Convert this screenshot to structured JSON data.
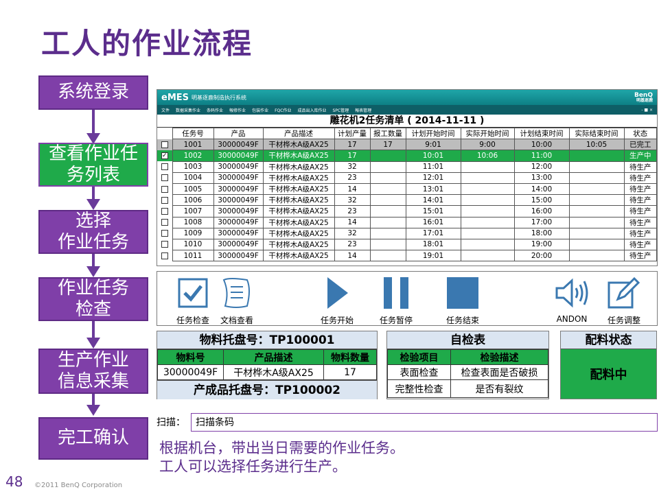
{
  "title": "工人的作业流程",
  "steps": [
    "系统登录",
    "查看作业任务列表",
    "选择作业任务",
    "作业任务检查",
    "生产作业信息采集",
    "完工确认"
  ],
  "step_lines": {
    "s2a": "查看作业任",
    "s2b": "务列表",
    "s3a": "选择",
    "s3b": "作业任务",
    "s4a": "作业任务",
    "s4b": "检查",
    "s5a": "生产作业",
    "s5b": "信息采集"
  },
  "app": {
    "logo": "eMES",
    "subtitle": "明基逐鹿制造执行系统",
    "brand_top": "BenQ",
    "brand_bottom": "明基逐鹿",
    "menu": [
      "文件",
      "数据采集作业",
      "条码作业",
      "報修作业",
      "包装作业",
      "FQC作业",
      "成品出入库作业",
      "SPC管理",
      "報表管理"
    ],
    "win_controls": "- ■ ×",
    "list_title": "雕花机2任务清单 ( 2014-11-11 )",
    "columns": [
      "任务号",
      "产品",
      "产品描述",
      "计划产量",
      "报工数量",
      "计划开始时间",
      "实际开始时间",
      "计划结束时间",
      "实际结束时间",
      "状态"
    ],
    "rows": [
      {
        "checked": false,
        "id": "1001",
        "product": "30000049F",
        "desc": "干材桦木A级AX25",
        "plan_qty": "17",
        "report_qty": "17",
        "plan_start": "9:01",
        "actual_start": "9:00",
        "plan_end": "10:00",
        "actual_end": "10:05",
        "status": "已完工"
      },
      {
        "checked": true,
        "id": "1002",
        "product": "30000049F",
        "desc": "干材桦木A级AX25",
        "plan_qty": "17",
        "report_qty": "",
        "plan_start": "10:01",
        "actual_start": "10:06",
        "plan_end": "11:00",
        "actual_end": "",
        "status": "生产中"
      },
      {
        "checked": false,
        "id": "1003",
        "product": "30000049F",
        "desc": "干材桦木A级AX25",
        "plan_qty": "32",
        "report_qty": "",
        "plan_start": "11:01",
        "actual_start": "",
        "plan_end": "12:00",
        "actual_end": "",
        "status": "待生产"
      },
      {
        "checked": false,
        "id": "1004",
        "product": "30000049F",
        "desc": "干材桦木A级AX25",
        "plan_qty": "23",
        "report_qty": "",
        "plan_start": "12:01",
        "actual_start": "",
        "plan_end": "13:00",
        "actual_end": "",
        "status": "待生产"
      },
      {
        "checked": false,
        "id": "1005",
        "product": "30000049F",
        "desc": "干材桦木A级AX25",
        "plan_qty": "14",
        "report_qty": "",
        "plan_start": "13:01",
        "actual_start": "",
        "plan_end": "14:00",
        "actual_end": "",
        "status": "待生产"
      },
      {
        "checked": false,
        "id": "1006",
        "product": "30000049F",
        "desc": "干材桦木A级AX25",
        "plan_qty": "32",
        "report_qty": "",
        "plan_start": "14:01",
        "actual_start": "",
        "plan_end": "15:00",
        "actual_end": "",
        "status": "待生产"
      },
      {
        "checked": false,
        "id": "1007",
        "product": "30000049F",
        "desc": "干材桦木A级AX25",
        "plan_qty": "23",
        "report_qty": "",
        "plan_start": "15:01",
        "actual_start": "",
        "plan_end": "16:00",
        "actual_end": "",
        "status": "待生产"
      },
      {
        "checked": false,
        "id": "1008",
        "product": "30000049F",
        "desc": "干材桦木A级AX25",
        "plan_qty": "14",
        "report_qty": "",
        "plan_start": "16:01",
        "actual_start": "",
        "plan_end": "17:00",
        "actual_end": "",
        "status": "待生产"
      },
      {
        "checked": false,
        "id": "1009",
        "product": "30000049F",
        "desc": "干材桦木A级AX25",
        "plan_qty": "32",
        "report_qty": "",
        "plan_start": "17:01",
        "actual_start": "",
        "plan_end": "18:00",
        "actual_end": "",
        "status": "待生产"
      },
      {
        "checked": false,
        "id": "1010",
        "product": "30000049F",
        "desc": "干材桦木A级AX25",
        "plan_qty": "23",
        "report_qty": "",
        "plan_start": "18:01",
        "actual_start": "",
        "plan_end": "19:00",
        "actual_end": "",
        "status": "待生产"
      },
      {
        "checked": false,
        "id": "1011",
        "product": "30000049F",
        "desc": "干材桦木A级AX25",
        "plan_qty": "14",
        "report_qty": "",
        "plan_start": "19:01",
        "actual_start": "",
        "plan_end": "20:00",
        "actual_end": "",
        "status": "待生产"
      }
    ]
  },
  "toolbar": {
    "check": "任务检查",
    "doc": "文档查看",
    "start": "任务开始",
    "pause": "任务暂停",
    "end": "任务结束",
    "andon": "ANDON",
    "adjust": "任务调整"
  },
  "material": {
    "pallet": "物料托盘号：TP100001",
    "col_no": "物料号",
    "col_desc": "产品描述",
    "col_qty": "物料数量",
    "no": "30000049F",
    "desc": "干材桦木A级AX25",
    "qty": "17",
    "product_pallet": "产成品托盘号：TP100002"
  },
  "selfcheck": {
    "title": "自检表",
    "col_item": "检验项目",
    "col_desc": "检验描述",
    "rows": [
      {
        "item": "表面检查",
        "desc": "检查表面是否破损"
      },
      {
        "item": "完整性检查",
        "desc": "是否有裂纹"
      }
    ]
  },
  "allocation": {
    "title": "配料状态",
    "status": "配料中"
  },
  "scan": {
    "label": "扫描：",
    "value": "扫描条码"
  },
  "note": {
    "line1": "根据机台，带出当日需要的作业任务。",
    "line2": "工人可以选择任务进行生产。"
  },
  "footer": {
    "page": "48",
    "copyright": "©2011 BenQ Corporation"
  },
  "colors": {
    "purple": "#7f3fa8",
    "green": "#1faa4a",
    "teal": "#0d7f85",
    "panel_header": "#dbe5f1",
    "tool_blue": "#3a78b0"
  },
  "icons": [
    "checkbox-icon",
    "document-icon",
    "play-icon",
    "pause-icon",
    "stop-icon",
    "speaker-icon",
    "edit-icon"
  ]
}
